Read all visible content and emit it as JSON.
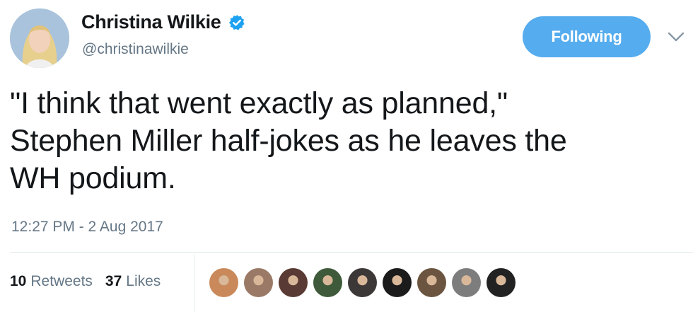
{
  "user": {
    "display_name": "Christina Wilkie",
    "handle": "@christinawilkie",
    "verified": true
  },
  "follow_button": {
    "label": "Following",
    "color": "#55acee"
  },
  "menu_caret_icon": "chevron-down-icon",
  "tweet": {
    "lines": [
      "\"I think that went exactly as planned,\"",
      "Stephen Miller half-jokes as he leaves the",
      "WH podium."
    ],
    "timestamp": "12:27 PM - 2 Aug 2017"
  },
  "stats": {
    "retweets": {
      "count": "10",
      "label": "Retweets"
    },
    "likes": {
      "count": "37",
      "label": "Likes"
    }
  },
  "liker_avatars": [
    {
      "color": "#c9895a"
    },
    {
      "color": "#9a7a66"
    },
    {
      "color": "#5a3a34"
    },
    {
      "color": "#3f5a3a"
    },
    {
      "color": "#3d3838"
    },
    {
      "color": "#1b1b1b"
    },
    {
      "color": "#6b5540"
    },
    {
      "color": "#7d7d7d"
    },
    {
      "color": "#222222"
    }
  ],
  "colors": {
    "text": "#14171a",
    "secondary": "#657786",
    "verified": "#1da1f2"
  }
}
